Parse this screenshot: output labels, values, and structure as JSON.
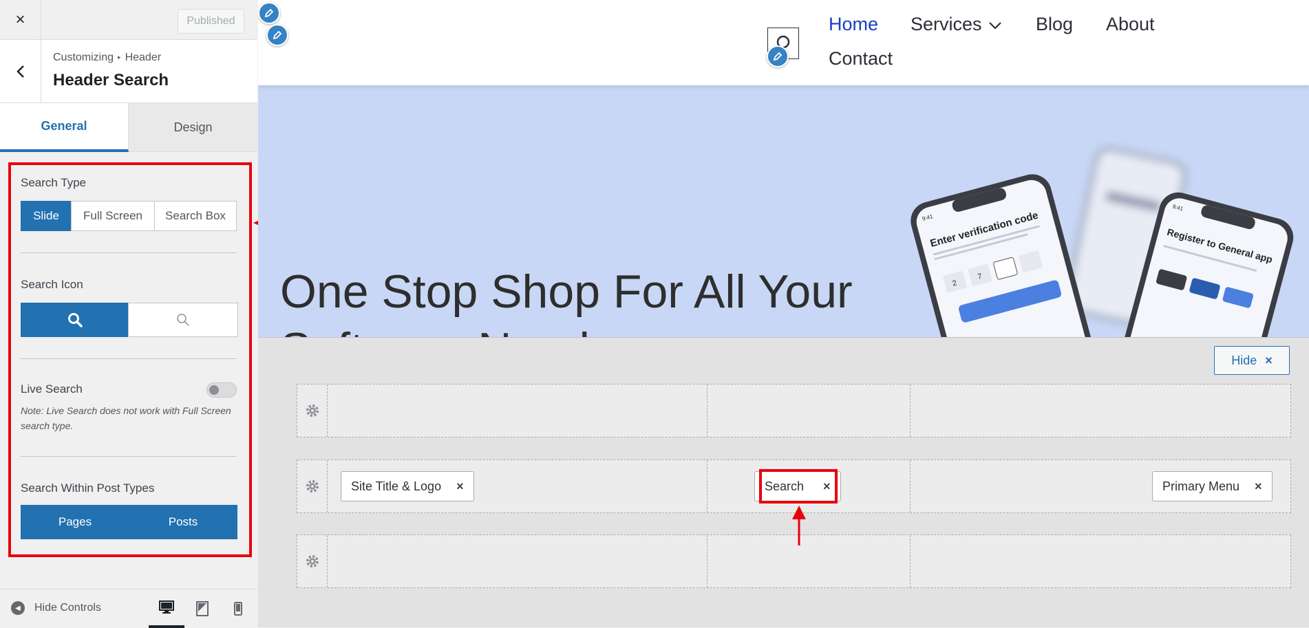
{
  "sidebar": {
    "close_icon": "×",
    "published_label": "Published",
    "breadcrumb": {
      "parent": "Customizing",
      "separator": "▸",
      "current": "Header"
    },
    "section_title": "Header Search",
    "tabs": [
      {
        "label": "General",
        "active": true
      },
      {
        "label": "Design",
        "active": false
      }
    ],
    "search_type": {
      "label": "Search Type",
      "options": [
        "Slide",
        "Full Screen",
        "Search Box"
      ],
      "selected": "Slide"
    },
    "search_icon": {
      "label": "Search Icon",
      "options": [
        "search-icon-bold",
        "search-icon-thin"
      ],
      "selected": "search-icon-bold"
    },
    "live_search": {
      "label": "Live Search",
      "enabled": false,
      "note": "Note: Live Search does not work with Full Screen search type."
    },
    "post_types": {
      "label": "Search Within Post Types",
      "options": [
        "Pages",
        "Posts"
      ],
      "selected": [
        "Pages",
        "Posts"
      ]
    },
    "footer": {
      "hide_controls_label": "Hide Controls",
      "devices": [
        "desktop-icon",
        "tablet-icon",
        "mobile-icon"
      ],
      "active_device": "desktop-icon"
    }
  },
  "preview": {
    "nav": [
      {
        "label": "Home",
        "active": true
      },
      {
        "label": "Services",
        "active": false,
        "has_dropdown": true
      },
      {
        "label": "Blog",
        "active": false
      },
      {
        "label": "About",
        "active": false
      },
      {
        "label": "Contact",
        "active": false
      }
    ],
    "hero_title": "One Stop Shop For All Your Software Needs",
    "phone_text": {
      "verification_title": "Enter verification code",
      "register_title": "Register to General app",
      "time": "9:41",
      "code_digits": [
        "2",
        "7"
      ]
    }
  },
  "builder": {
    "hide_label": "Hide",
    "hide_icon": "×",
    "rows": [
      {
        "items": []
      },
      {
        "items": [
          {
            "label": "Site Title & Logo",
            "column": "left"
          },
          {
            "label": "Search",
            "column": "center"
          },
          {
            "label": "Primary Menu",
            "column": "right"
          }
        ]
      },
      {
        "items": []
      }
    ],
    "remove_icon": "×"
  },
  "colors": {
    "accent": "#2271b1",
    "highlight": "#e8000b",
    "hero_bg": "#c8d7f5",
    "nav_active": "#1a3cc8"
  }
}
